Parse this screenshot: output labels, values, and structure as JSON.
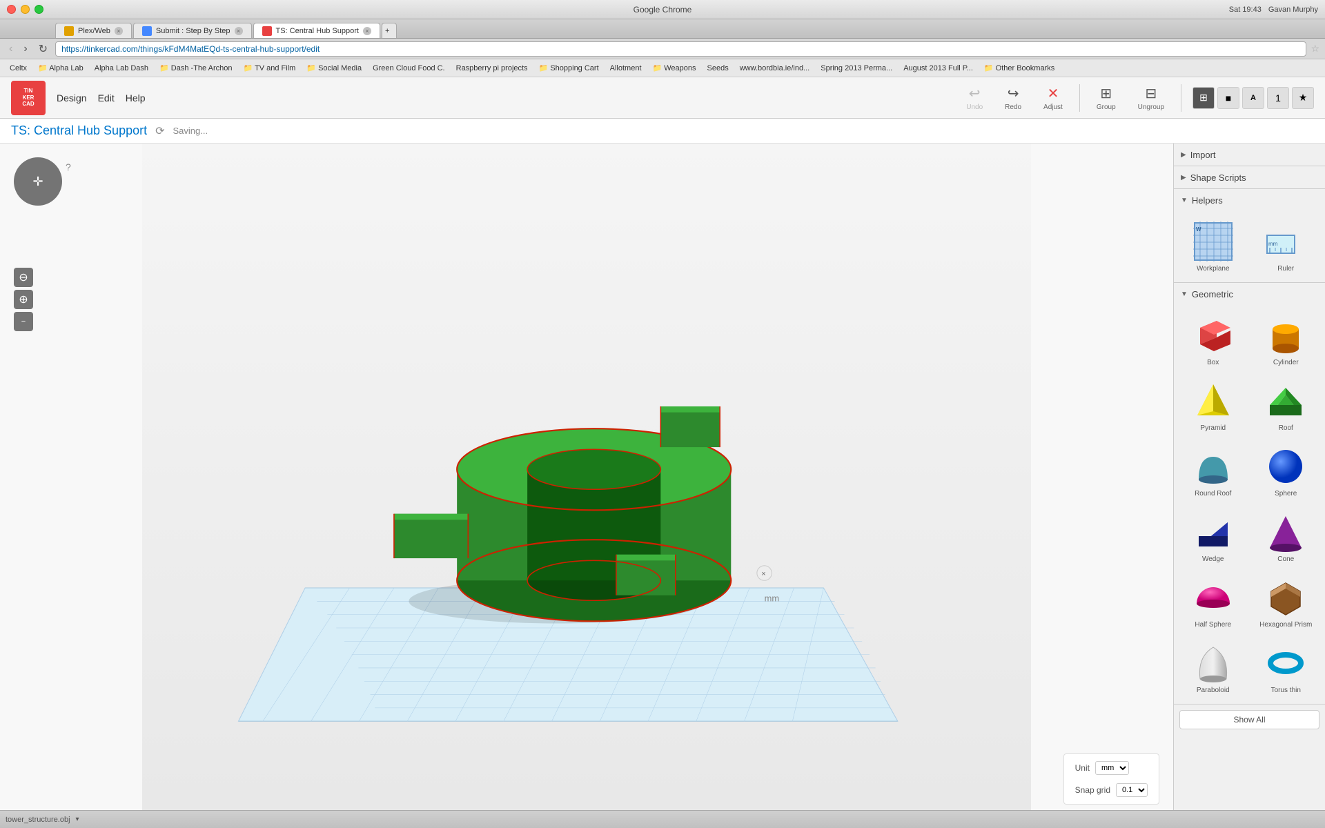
{
  "os": {
    "title": "Google Chrome",
    "datetime": "Sat 19:43",
    "user": "Gavan Murphy"
  },
  "browser": {
    "name": "Chrome",
    "tabs": [
      {
        "id": "tab1",
        "title": "Plex/Web",
        "url": "plex.tv",
        "active": false
      },
      {
        "id": "tab2",
        "title": "Submit : Step By Step",
        "url": "...",
        "active": false
      },
      {
        "id": "tab3",
        "title": "TS: Central Hub Support",
        "url": "https://tinkercad.com/things/kFdM4MatEQd-ts-central-hub-support/edit",
        "active": true
      }
    ],
    "address": "https://tinkercad.com/things/kFdM4MatEQd-ts-central-hub-support/edit",
    "bookmarks": [
      "Celtx",
      "Alpha Lab",
      "Alpha Lab Dash",
      "Dash -The Archon",
      "TV and Film",
      "Social Media",
      "Green Cloud Food C.",
      "Raspberry pi projects",
      "Shopping Cart",
      "Allotment",
      "Weapons",
      "Seeds",
      "www.bordbia.ie/ind...",
      "Spring 2013 Perma...",
      "August 2013 Full P...",
      "Other Bookmarks"
    ]
  },
  "app": {
    "logo_line1": "TINKER",
    "logo_line2": "CAD",
    "nav": {
      "design": "Design",
      "edit": "Edit",
      "help": "Help"
    },
    "toolbar": {
      "undo_label": "Undo",
      "redo_label": "Redo",
      "adjust_label": "Adjust",
      "group_label": "Group",
      "ungroup_label": "Ungroup"
    },
    "project_title": "TS: Central Hub Support",
    "saving_text": "Saving...",
    "unit_label": "Unit",
    "unit_value": "mm",
    "snap_grid_label": "Snap grid",
    "snap_grid_value": "0.1"
  },
  "right_panel": {
    "import_label": "Import",
    "shape_scripts_label": "Shape Scripts",
    "helpers_label": "Helpers",
    "geometric_label": "Geometric",
    "helpers": [
      {
        "id": "workplane",
        "label": "Workplane"
      },
      {
        "id": "ruler",
        "label": "Ruler"
      }
    ],
    "geometric_shapes": [
      {
        "id": "box",
        "label": "Box",
        "color": "#dd2222"
      },
      {
        "id": "cylinder",
        "label": "Cylinder",
        "color": "#dd8800"
      },
      {
        "id": "pyramid",
        "label": "Pyramid",
        "color": "#ddcc00"
      },
      {
        "id": "roof",
        "label": "Roof",
        "color": "#229922"
      },
      {
        "id": "round-roof",
        "label": "Round Roof",
        "color": "#4499aa"
      },
      {
        "id": "sphere",
        "label": "Sphere",
        "color": "#2255dd"
      },
      {
        "id": "wedge",
        "label": "Wedge",
        "color": "#112288"
      },
      {
        "id": "cone",
        "label": "Cone",
        "color": "#882299"
      },
      {
        "id": "half-sphere",
        "label": "Half Sphere",
        "color": "#cc2299"
      },
      {
        "id": "hexagonal-prism",
        "label": "Hexagonal Prism",
        "color": "#884422"
      },
      {
        "id": "paraboloid",
        "label": "Paraboloid",
        "color": "#aaaaaa"
      },
      {
        "id": "torus-thin",
        "label": "Torus thin",
        "color": "#0099cc"
      }
    ],
    "show_all_label": "Show All"
  },
  "statusbar": {
    "filename": "tower_structure.obj",
    "mm_label": "mm"
  }
}
